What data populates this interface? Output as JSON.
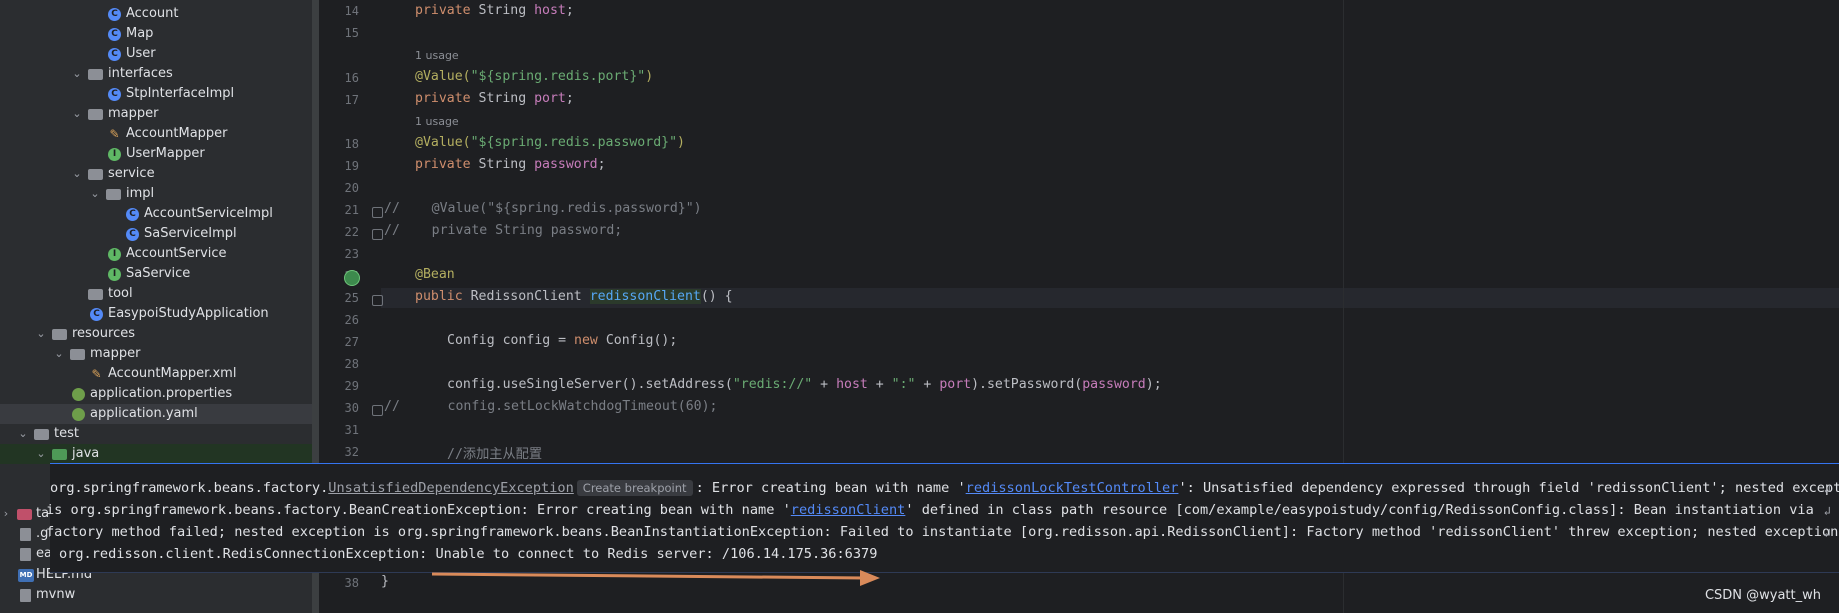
{
  "tree": {
    "items": [
      {
        "label": "Account",
        "icon": "class-icon"
      },
      {
        "label": "Map",
        "icon": "class-icon"
      },
      {
        "label": "User",
        "icon": "class-icon"
      },
      {
        "label": "interfaces",
        "icon": "folder-icon"
      },
      {
        "label": "StpInterfaceImpl",
        "icon": "class-icon"
      },
      {
        "label": "mapper",
        "icon": "folder-icon"
      },
      {
        "label": "AccountMapper",
        "icon": "mapper-icon"
      },
      {
        "label": "UserMapper",
        "icon": "interface-icon"
      },
      {
        "label": "service",
        "icon": "folder-icon"
      },
      {
        "label": "impl",
        "icon": "folder-icon"
      },
      {
        "label": "AccountServiceImpl",
        "icon": "class-icon"
      },
      {
        "label": "SaServiceImpl",
        "icon": "class-icon"
      },
      {
        "label": "AccountService",
        "icon": "interface-icon"
      },
      {
        "label": "SaService",
        "icon": "interface-icon"
      },
      {
        "label": "tool",
        "icon": "folder-icon"
      },
      {
        "label": "EasypoiStudyApplication",
        "icon": "spring-app-icon"
      },
      {
        "label": "resources",
        "icon": "resources-folder-icon"
      },
      {
        "label": "mapper",
        "icon": "folder-icon"
      },
      {
        "label": "AccountMapper.xml",
        "icon": "xml-icon"
      },
      {
        "label": "application.properties",
        "icon": "properties-icon"
      },
      {
        "label": "application.yaml",
        "icon": "yaml-icon"
      },
      {
        "label": "test",
        "icon": "folder-icon"
      },
      {
        "label": "java",
        "icon": "test-folder-icon"
      },
      {
        "label": "tar",
        "icon": "folder-icon"
      },
      {
        "label": ".gi",
        "icon": "file-icon"
      },
      {
        "label": "eas",
        "icon": "file-icon"
      },
      {
        "label": "HELP.md",
        "icon": "markdown-icon"
      },
      {
        "label": "mvnw",
        "icon": "file-icon"
      }
    ]
  },
  "editor": {
    "usage_hint": "1 usage",
    "line_numbers": [
      "14",
      "15",
      "16",
      "17",
      "18",
      "19",
      "20",
      "21",
      "22",
      "23",
      "24",
      "25",
      "26",
      "27",
      "28",
      "29",
      "30",
      "31",
      "32",
      "38"
    ],
    "lines": {
      "l14": {
        "kw": "private",
        "type": " String ",
        "field": "host",
        "end": ";"
      },
      "l16": {
        "ann": "@Value(",
        "str": "\"${spring.redis.port}\"",
        "end": ")"
      },
      "l17": {
        "kw": "private",
        "type": " String ",
        "field": "port",
        "end": ";"
      },
      "l18": {
        "ann": "@Value(",
        "str": "\"${spring.redis.password}\"",
        "end": ")"
      },
      "l19": {
        "kw": "private",
        "type": " String ",
        "field": "password",
        "end": ";"
      },
      "l21": {
        "mark": "//",
        "text": "    @Value(\"${spring.redis.password}\")"
      },
      "l22": {
        "mark": "//",
        "text": "    private String password;"
      },
      "l24": {
        "ann": "@Bean"
      },
      "l25": {
        "kw": "public",
        "type": " RedissonClient ",
        "fn": "redissonClient",
        "end": "() {"
      },
      "l27": {
        "pre": "Config config = ",
        "kw": "new",
        "end": " Config();"
      },
      "l29": {
        "pre": "config.useSingleServer().setAddress(",
        "str1": "\"redis://\"",
        "mid1": " + ",
        "f1": "host",
        "mid2": " + ",
        "str2": "\":\"",
        "mid3": " + ",
        "f2": "port",
        "mid4": ").setPassword(",
        "f3": "password",
        "end": ");"
      },
      "l30": {
        "mark": "//",
        "text": "      config.setLockWatchdogTimeout(60);"
      },
      "l32": {
        "text": "//添加主从配置"
      },
      "l38": {
        "text": "}"
      }
    }
  },
  "popup": {
    "line1_prefix": "org.springframework.beans.factory.",
    "line1_exception": "UnsatisfiedDependencyException",
    "create_breakpoint": "Create breakpoint",
    "line1_mid": ": Error creating bean with name '",
    "line1_bean": "redissonLockTestController",
    "line1_rest": "': Unsatisfied dependency expressed through field 'redissonClient'; nested exception",
    "line2_prefix": "is org.springframework.beans.factory.BeanCreationException: Error creating bean with name '",
    "line2_bean": "redissonClient",
    "line2_rest": "' defined in class path resource [com/example/easypoistudy/config/RedissonConfig.class]: Bean instantiation via",
    "line3": "factory method failed; nested exception is org.springframework.beans.BeanInstantiationException: Failed to instantiate [org.redisson.api.RedissonClient]: Factory method 'redissonClient' threw exception; nested exception is",
    "line4": "org.redisson.client.RedisConnectionException: Unable to connect to Redis server: /106.14.175.36:6379"
  },
  "watermark": "CSDN @wyatt_wh",
  "colors": {
    "accent": "#3574f0",
    "arrow": "#d98a5a"
  }
}
